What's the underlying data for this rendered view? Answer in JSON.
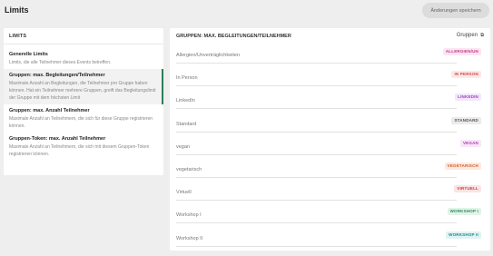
{
  "header": {
    "title": "Limits",
    "save_label": "Änderungen speichern"
  },
  "left": {
    "title": "LIMITS",
    "items": [
      {
        "title": "Generelle Limits",
        "desc": "Limits, die alle Teilnehmer dieses Events betreffen."
      },
      {
        "title": "Gruppen: max. Begleitungen/Teilnehmer",
        "desc": "Maximale Anzahl an Begleitungen, die Teilnehmer pro Gruppe haben können. Hat ein Teilnehmer mehrere Gruppen, greift das Begleitungslimit der Gruppe mit dem höchsten Limit"
      },
      {
        "title": "Gruppen: max. Anzahl Teilnehmer",
        "desc": "Maximale Anzahl an Teilnehmern, die sich für diese Gruppe registrieren können."
      },
      {
        "title": "Gruppen-Token: max. Anzahl Teilnehmer",
        "desc": "Maximale Anzahl an Teilnehmern, die sich mit diesem Gruppen-Token registrieren können."
      }
    ]
  },
  "right": {
    "title": "GRUPPEN: MAX. BEGLEITUNGEN/TEILNEHMER",
    "link_label": "Gruppen",
    "link_icon": "external-link-icon",
    "rows": [
      {
        "label": "Allergien/Unverträglichkeiten",
        "badge": "ALLERGIEN/UN",
        "color": "#c0398a",
        "bg": "#fbe6f1"
      },
      {
        "label": "In Person",
        "badge": "IN PERSON",
        "color": "#d64545",
        "bg": "#fde8e8"
      },
      {
        "label": "LinkedIn",
        "badge": "LINKEDIN",
        "color": "#9c3fc4",
        "bg": "#f3e6fa"
      },
      {
        "label": "Standard",
        "badge": "STANDARD",
        "color": "#555555",
        "bg": "#ebebeb"
      },
      {
        "label": "vegan",
        "badge": "VEGAN",
        "color": "#b03ab0",
        "bg": "#f8e5f8"
      },
      {
        "label": "vegetarisch",
        "badge": "VEGETARISCH",
        "color": "#d65a2a",
        "bg": "#fde9df"
      },
      {
        "label": "Virtuell",
        "badge": "VIRTUELL",
        "color": "#cc3b3b",
        "bg": "#fbe4e4"
      },
      {
        "label": "Workshop I",
        "badge": "WORKSHOP I",
        "color": "#2e8a5a",
        "bg": "#e3f4ea"
      },
      {
        "label": "Workshop II",
        "badge": "WORKSHOP II",
        "color": "#1f8a8a",
        "bg": "#e0f3f3"
      }
    ]
  }
}
